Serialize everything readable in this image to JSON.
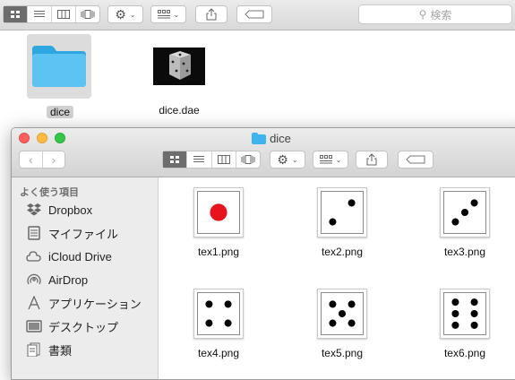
{
  "back_window": {
    "search_placeholder": "検索",
    "items": [
      {
        "label": "dice",
        "icon": "folder-icon",
        "selected": true
      },
      {
        "label": "dice.dae",
        "icon": "dice-render-thumbnail"
      }
    ]
  },
  "front_window": {
    "title": "dice",
    "sidebar": {
      "section_title": "よく使う項目",
      "items": [
        {
          "label": "Dropbox",
          "icon": "dropbox-icon"
        },
        {
          "label": "マイファイル",
          "icon": "all-my-files-icon"
        },
        {
          "label": "iCloud Drive",
          "icon": "cloud-icon"
        },
        {
          "label": "AirDrop",
          "icon": "airdrop-icon"
        },
        {
          "label": "アプリケーション",
          "icon": "applications-icon"
        },
        {
          "label": "デスクトップ",
          "icon": "desktop-icon"
        },
        {
          "label": "書類",
          "icon": "documents-icon"
        }
      ]
    },
    "files": [
      {
        "name": "tex1.png",
        "pips": 1
      },
      {
        "name": "tex2.png",
        "pips": 2
      },
      {
        "name": "tex3.png",
        "pips": 3
      },
      {
        "name": "tex4.png",
        "pips": 4
      },
      {
        "name": "tex5.png",
        "pips": 5
      },
      {
        "name": "tex6.png",
        "pips": 6
      }
    ]
  },
  "colors": {
    "folder_blue": "#3fb4ec",
    "one_pip_red": "#e8131d",
    "selection_gray": "#dcdcdc",
    "close": "#fc605c",
    "minimize": "#fdbc40",
    "zoom": "#34c84a"
  }
}
